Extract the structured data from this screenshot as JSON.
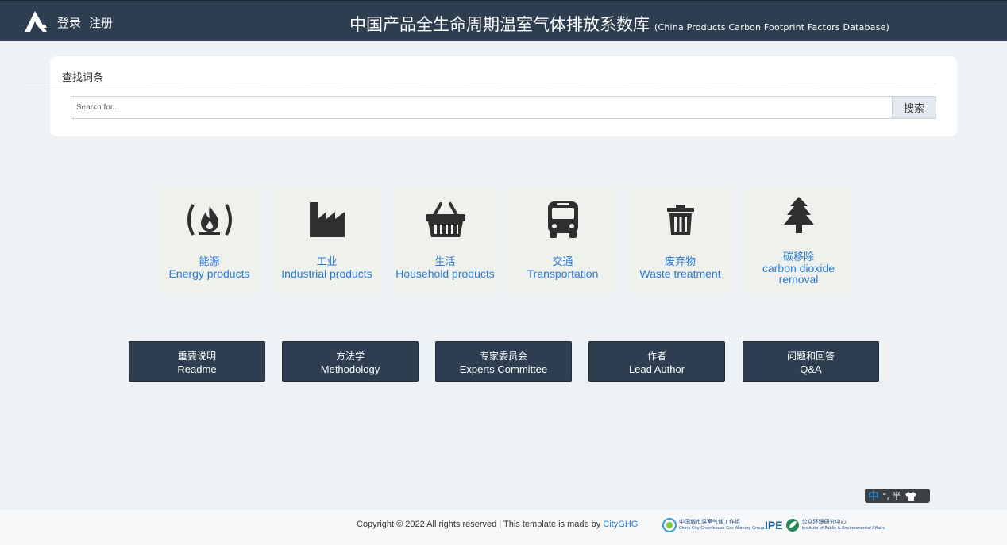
{
  "header": {
    "login_label": "登录",
    "register_label": "注册",
    "title": "中国产品全生命周期温室气体排放系数库",
    "subtitle": "(China Products Carbon Footprint Factors Database)"
  },
  "search": {
    "heading": "查找词条",
    "placeholder": "Search for...",
    "button_label": "搜索"
  },
  "categories": [
    {
      "cn": "能源",
      "en": "Energy products",
      "icon": "fire-icon"
    },
    {
      "cn": "工业",
      "en": "Industrial products",
      "icon": "factory-icon"
    },
    {
      "cn": "生活",
      "en": "Household products",
      "icon": "basket-icon"
    },
    {
      "cn": "交通",
      "en": "Transportation",
      "icon": "bus-icon"
    },
    {
      "cn": "废弃物",
      "en": "Waste treatment",
      "icon": "trash-icon"
    },
    {
      "cn": "碳移除",
      "en": "carbon dioxide removal",
      "icon": "tree-icon"
    }
  ],
  "info_buttons": [
    {
      "cn": "重要说明",
      "en": "Readme"
    },
    {
      "cn": "方法学",
      "en": "Methodology"
    },
    {
      "cn": "专家委员会",
      "en": "Experts Committee"
    },
    {
      "cn": "作者",
      "en": "Lead Author"
    },
    {
      "cn": "问题和回答",
      "en": "Q&A"
    }
  ],
  "ime": {
    "mode": "中",
    "extra": "°, 半"
  },
  "footer": {
    "copyright": "Copyright © 2022 All rights reserved | This template is made by ",
    "link_label": "CityGHG",
    "partner1_line1": "中国城市温室气体工作组",
    "partner1_line2": "China City Greenhouse Gas Working Group",
    "partner2_mark": "IPE",
    "partner2_line1": "公众环境研究中心",
    "partner2_line2": "Institute of Public & Environmental Affairs"
  },
  "colors": {
    "header_bg": "#2c3e50",
    "link_blue": "#2a7bd6",
    "page_bg": "#eff2f5"
  }
}
